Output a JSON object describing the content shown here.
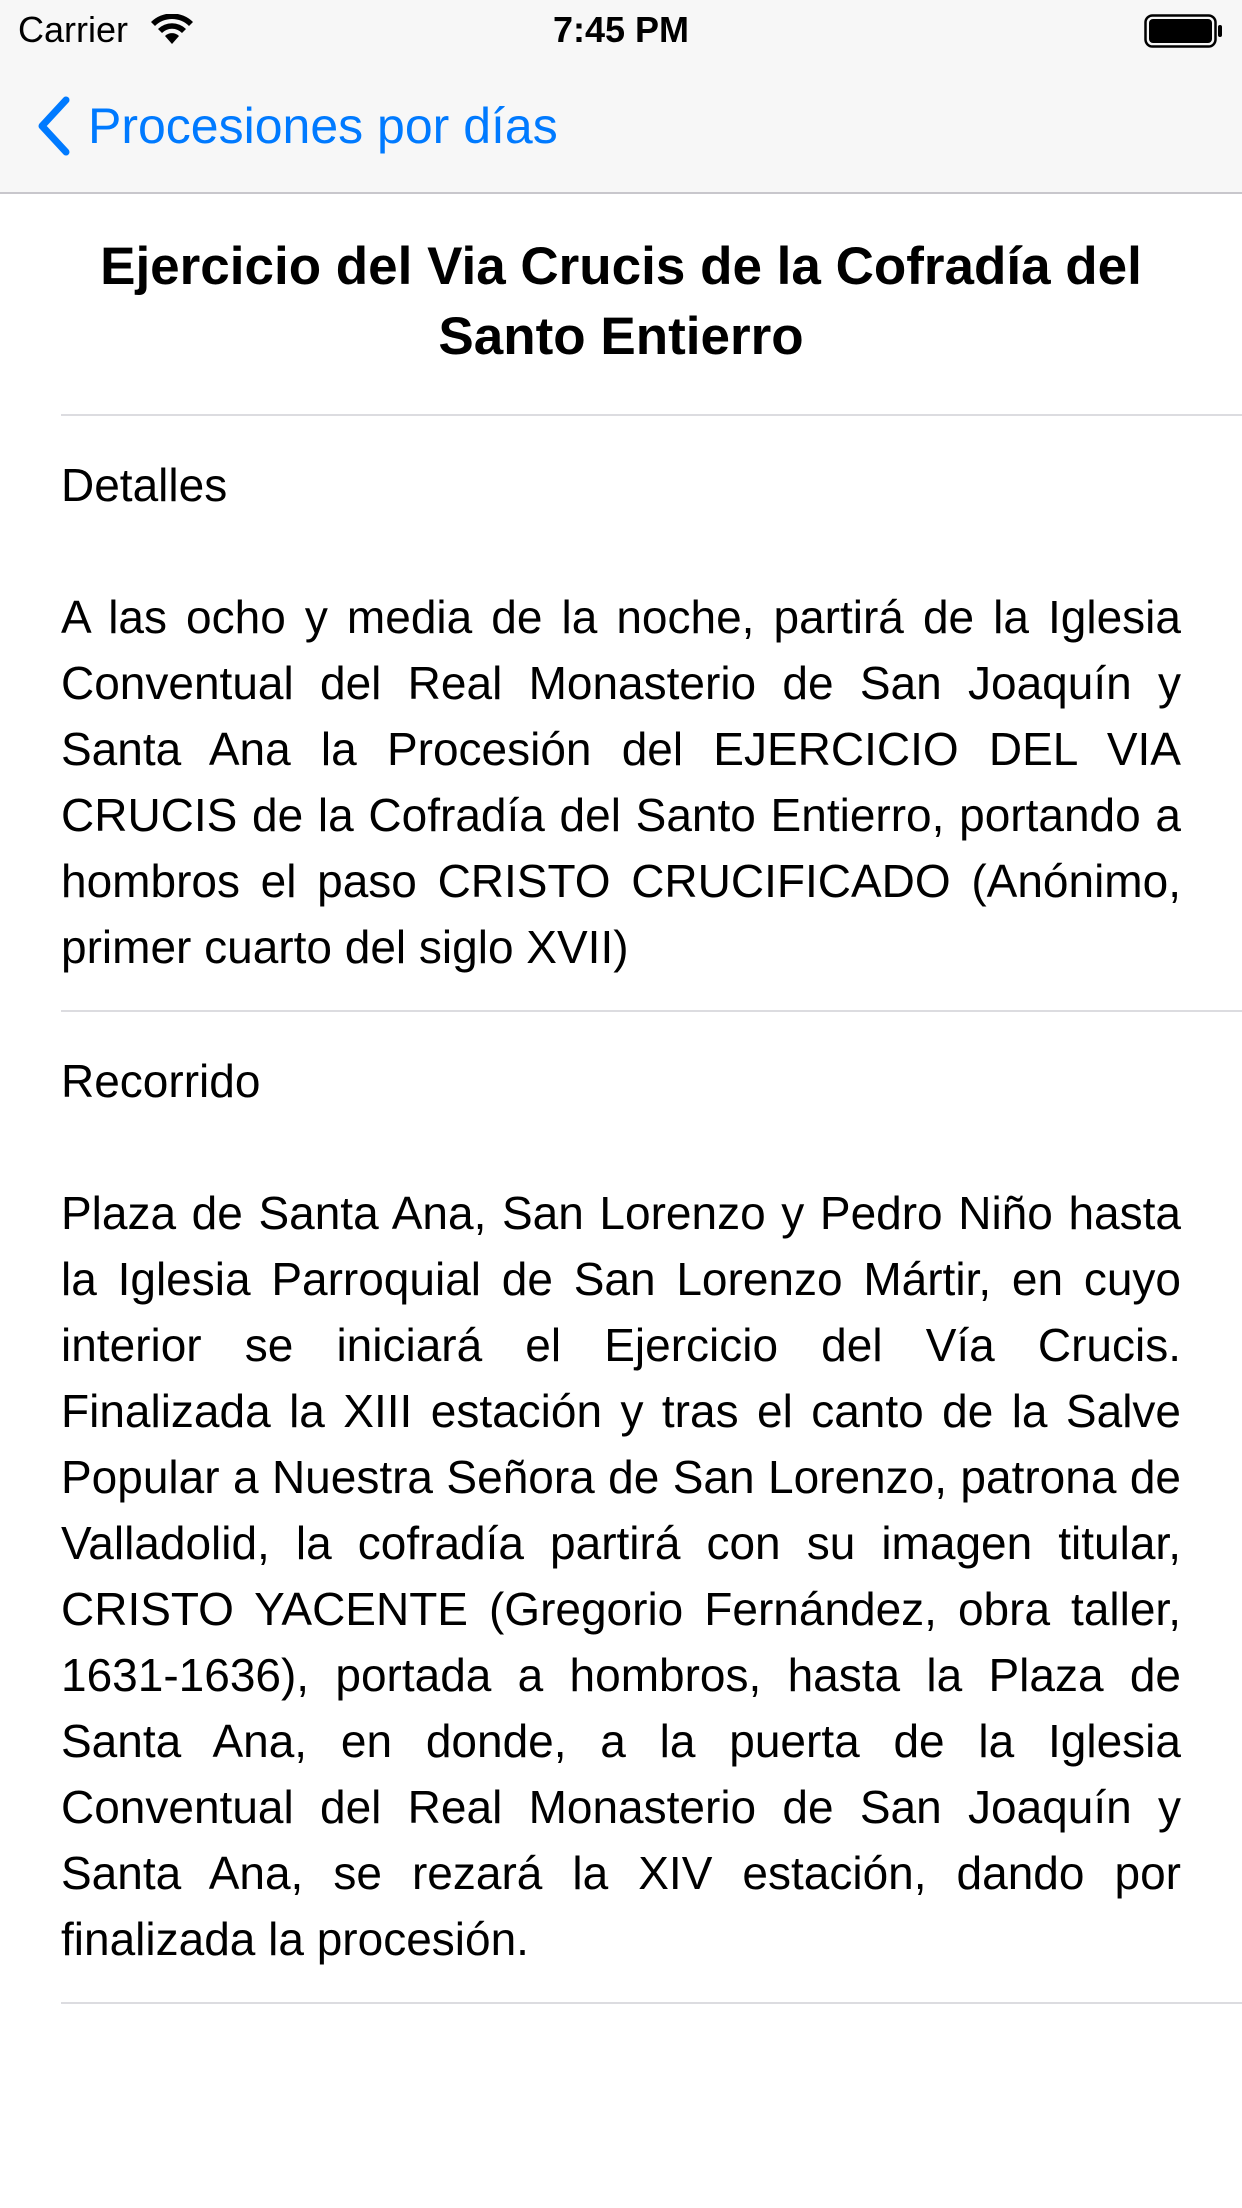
{
  "status_bar": {
    "carrier": "Carrier",
    "time": "7:45 PM"
  },
  "nav": {
    "back_label": "Procesiones por días",
    "accent_color": "#007aff"
  },
  "page": {
    "title": "Ejercicio del Via Crucis de la Cofradía del Santo Entierro"
  },
  "sections": [
    {
      "heading": "Detalles",
      "body": "A las ocho y media de la noche, partirá de la Iglesia Conventual del Real Monasterio de San Joaquín y Santa Ana la Procesión del EJERCICIO DEL VIA CRUCIS de la Cofradía del Santo Entierro, portando a hombros el paso CRISTO CRUCIFICADO (Anónimo, primer cuarto del siglo XVII)"
    },
    {
      "heading": "Recorrido",
      "body": "Plaza de Santa Ana, San Lorenzo y Pedro Niño hasta la Iglesia Parroquial de San Lorenzo Mártir, en cuyo interior se iniciará el Ejercicio del Vía Crucis. Finalizada la XIII estación y tras el canto de la Salve Popular a Nuestra Señora de San Lorenzo, patrona de Valladolid, la cofradía partirá con su imagen titular, CRISTO YACENTE (Gregorio Fernández, obra taller, 1631-1636), portada a hombros, hasta la Plaza de Santa Ana, en donde, a la puerta de la Iglesia Conventual del Real Monasterio de San Joaquín y Santa Ana, se rezará la XIV estación, dando por finalizada la procesión."
    }
  ],
  "icons": {
    "wifi": "wifi-icon",
    "battery": "battery-icon",
    "back": "chevron-left-icon"
  }
}
